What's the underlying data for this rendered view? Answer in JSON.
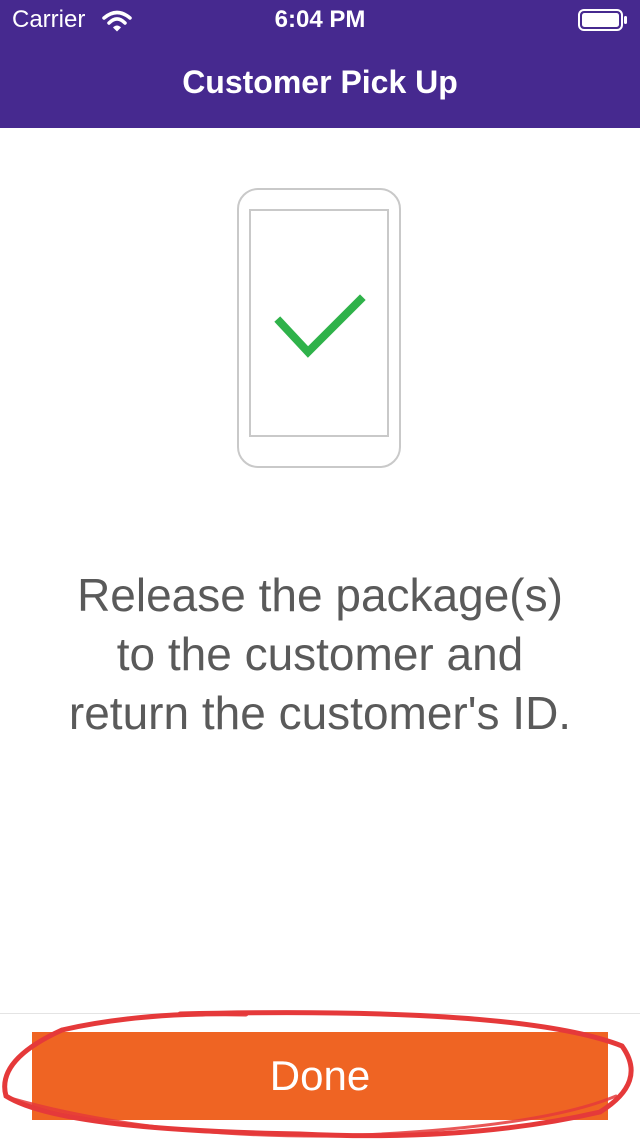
{
  "status_bar": {
    "carrier": "Carrier",
    "time": "6:04 PM",
    "icons": [
      "wifi-icon",
      "battery-icon"
    ]
  },
  "nav": {
    "title": "Customer Pick Up"
  },
  "illustration": {
    "icons": [
      "phone-icon",
      "checkmark-icon"
    ],
    "check_color": "#2fb24a"
  },
  "message": {
    "lines": [
      "Release the package(s)",
      "to the customer and",
      "return the customer's ID."
    ]
  },
  "footer": {
    "done_label": "Done"
  },
  "colors": {
    "header": "#46298f",
    "button": "#ef6423",
    "annotation_circle": "#e5393a"
  }
}
